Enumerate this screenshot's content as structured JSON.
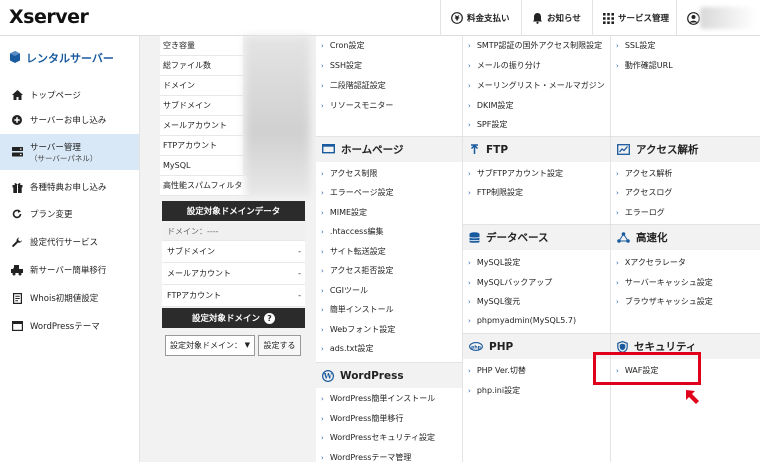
{
  "header": {
    "logo": "Xserver",
    "payment": "料金支払い",
    "notice": "お知らせ",
    "service": "サービス管理"
  },
  "sidebar": {
    "title": "レンタルサーバー",
    "items": [
      {
        "label": "トップページ",
        "icon": "home-icon"
      },
      {
        "label": "サーバーお申し込み",
        "icon": "plus-circle-icon"
      },
      {
        "label": "サーバー管理",
        "sub": "（サーバーパネル）",
        "icon": "server-icon"
      },
      {
        "label": "各種特典お申し込み",
        "icon": "gift-icon"
      },
      {
        "label": "プラン変更",
        "icon": "refresh-icon"
      },
      {
        "label": "設定代行サービス",
        "icon": "wrench-icon"
      },
      {
        "label": "新サーバー簡単移行",
        "icon": "truck-icon"
      },
      {
        "label": "Whois初期値設定",
        "icon": "document-icon"
      },
      {
        "label": "WordPressテーマ",
        "icon": "window-icon"
      }
    ]
  },
  "domain_panel": {
    "stats": [
      "空き容量",
      "総ファイル数",
      "ドメイン",
      "サブドメイン",
      "メールアカウント",
      "FTPアカウント",
      "MySQL",
      "高性能スパムフィルタ"
    ],
    "target_head": "設定対象ドメインデータ",
    "domain_row": "ドメイン：----",
    "info_rows": [
      {
        "label": "サブドメイン",
        "value": "-"
      },
      {
        "label": "メールアカウント",
        "value": "-"
      },
      {
        "label": "FTPアカウント",
        "value": "-"
      }
    ],
    "target_domain_head": "設定対象ドメイン",
    "select_value": "設定対象ドメイン：",
    "set_button": "設定する"
  },
  "col1": {
    "top_links": [
      "Cron設定",
      "SSH設定",
      "二段階認証設定",
      "リソースモニター"
    ],
    "homepage_title": "ホームページ",
    "homepage_links": [
      "アクセス制限",
      "エラーページ設定",
      "MIME設定",
      ".htaccess編集",
      "サイト転送設定",
      "アクセス拒否設定",
      "CGIツール",
      "簡単インストール",
      "Webフォント設定",
      "ads.txt設定"
    ],
    "wordpress_title": "WordPress",
    "wordpress_links": [
      "WordPress簡単インストール",
      "WordPress簡単移行",
      "WordPressセキュリティ設定",
      "WordPressテーマ管理"
    ]
  },
  "col2": {
    "top_links": [
      "SMTP認証の国外アクセス制限設定",
      "メールの振り分け",
      "メーリングリスト・メールマガジン",
      "DKIM設定",
      "SPF設定"
    ],
    "ftp_title": "FTP",
    "ftp_links": [
      "サブFTPアカウント設定",
      "FTP制限設定"
    ],
    "db_title": "データベース",
    "db_links": [
      "MySQL設定",
      "MySQLバックアップ",
      "MySQL復元",
      "phpmyadmin(MySQL5.7)"
    ],
    "php_title": "PHP",
    "php_links": [
      "PHP Ver.切替",
      "php.ini設定"
    ]
  },
  "col3": {
    "top_links": [
      "SSL設定",
      "動作確認URL"
    ],
    "access_title": "アクセス解析",
    "access_links": [
      "アクセス解析",
      "アクセスログ",
      "エラーログ"
    ],
    "speed_title": "高速化",
    "speed_links": [
      "Xアクセラレータ",
      "サーバーキャッシュ設定",
      "ブラウザキャッシュ設定"
    ],
    "security_title": "セキュリティ",
    "security_links": [
      "WAF設定"
    ]
  },
  "colors": {
    "accent": "#1a5a9e",
    "highlight": "#e0001b",
    "active_bg": "#d9e8f6"
  }
}
